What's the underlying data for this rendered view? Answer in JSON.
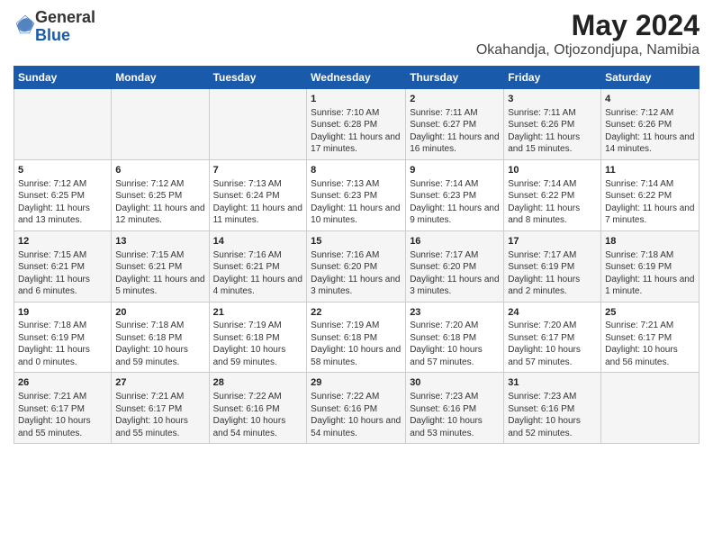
{
  "logo": {
    "general": "General",
    "blue": "Blue"
  },
  "title": "May 2024",
  "subtitle": "Okahandja, Otjozondjupa, Namibia",
  "days_of_week": [
    "Sunday",
    "Monday",
    "Tuesday",
    "Wednesday",
    "Thursday",
    "Friday",
    "Saturday"
  ],
  "weeks": [
    [
      {
        "num": "",
        "info": ""
      },
      {
        "num": "",
        "info": ""
      },
      {
        "num": "",
        "info": ""
      },
      {
        "num": "1",
        "info": "Sunrise: 7:10 AM\nSunset: 6:28 PM\nDaylight: 11 hours and 17 minutes."
      },
      {
        "num": "2",
        "info": "Sunrise: 7:11 AM\nSunset: 6:27 PM\nDaylight: 11 hours and 16 minutes."
      },
      {
        "num": "3",
        "info": "Sunrise: 7:11 AM\nSunset: 6:26 PM\nDaylight: 11 hours and 15 minutes."
      },
      {
        "num": "4",
        "info": "Sunrise: 7:12 AM\nSunset: 6:26 PM\nDaylight: 11 hours and 14 minutes."
      }
    ],
    [
      {
        "num": "5",
        "info": "Sunrise: 7:12 AM\nSunset: 6:25 PM\nDaylight: 11 hours and 13 minutes."
      },
      {
        "num": "6",
        "info": "Sunrise: 7:12 AM\nSunset: 6:25 PM\nDaylight: 11 hours and 12 minutes."
      },
      {
        "num": "7",
        "info": "Sunrise: 7:13 AM\nSunset: 6:24 PM\nDaylight: 11 hours and 11 minutes."
      },
      {
        "num": "8",
        "info": "Sunrise: 7:13 AM\nSunset: 6:23 PM\nDaylight: 11 hours and 10 minutes."
      },
      {
        "num": "9",
        "info": "Sunrise: 7:14 AM\nSunset: 6:23 PM\nDaylight: 11 hours and 9 minutes."
      },
      {
        "num": "10",
        "info": "Sunrise: 7:14 AM\nSunset: 6:22 PM\nDaylight: 11 hours and 8 minutes."
      },
      {
        "num": "11",
        "info": "Sunrise: 7:14 AM\nSunset: 6:22 PM\nDaylight: 11 hours and 7 minutes."
      }
    ],
    [
      {
        "num": "12",
        "info": "Sunrise: 7:15 AM\nSunset: 6:21 PM\nDaylight: 11 hours and 6 minutes."
      },
      {
        "num": "13",
        "info": "Sunrise: 7:15 AM\nSunset: 6:21 PM\nDaylight: 11 hours and 5 minutes."
      },
      {
        "num": "14",
        "info": "Sunrise: 7:16 AM\nSunset: 6:21 PM\nDaylight: 11 hours and 4 minutes."
      },
      {
        "num": "15",
        "info": "Sunrise: 7:16 AM\nSunset: 6:20 PM\nDaylight: 11 hours and 3 minutes."
      },
      {
        "num": "16",
        "info": "Sunrise: 7:17 AM\nSunset: 6:20 PM\nDaylight: 11 hours and 3 minutes."
      },
      {
        "num": "17",
        "info": "Sunrise: 7:17 AM\nSunset: 6:19 PM\nDaylight: 11 hours and 2 minutes."
      },
      {
        "num": "18",
        "info": "Sunrise: 7:18 AM\nSunset: 6:19 PM\nDaylight: 11 hours and 1 minute."
      }
    ],
    [
      {
        "num": "19",
        "info": "Sunrise: 7:18 AM\nSunset: 6:19 PM\nDaylight: 11 hours and 0 minutes."
      },
      {
        "num": "20",
        "info": "Sunrise: 7:18 AM\nSunset: 6:18 PM\nDaylight: 10 hours and 59 minutes."
      },
      {
        "num": "21",
        "info": "Sunrise: 7:19 AM\nSunset: 6:18 PM\nDaylight: 10 hours and 59 minutes."
      },
      {
        "num": "22",
        "info": "Sunrise: 7:19 AM\nSunset: 6:18 PM\nDaylight: 10 hours and 58 minutes."
      },
      {
        "num": "23",
        "info": "Sunrise: 7:20 AM\nSunset: 6:18 PM\nDaylight: 10 hours and 57 minutes."
      },
      {
        "num": "24",
        "info": "Sunrise: 7:20 AM\nSunset: 6:17 PM\nDaylight: 10 hours and 57 minutes."
      },
      {
        "num": "25",
        "info": "Sunrise: 7:21 AM\nSunset: 6:17 PM\nDaylight: 10 hours and 56 minutes."
      }
    ],
    [
      {
        "num": "26",
        "info": "Sunrise: 7:21 AM\nSunset: 6:17 PM\nDaylight: 10 hours and 55 minutes."
      },
      {
        "num": "27",
        "info": "Sunrise: 7:21 AM\nSunset: 6:17 PM\nDaylight: 10 hours and 55 minutes."
      },
      {
        "num": "28",
        "info": "Sunrise: 7:22 AM\nSunset: 6:16 PM\nDaylight: 10 hours and 54 minutes."
      },
      {
        "num": "29",
        "info": "Sunrise: 7:22 AM\nSunset: 6:16 PM\nDaylight: 10 hours and 54 minutes."
      },
      {
        "num": "30",
        "info": "Sunrise: 7:23 AM\nSunset: 6:16 PM\nDaylight: 10 hours and 53 minutes."
      },
      {
        "num": "31",
        "info": "Sunrise: 7:23 AM\nSunset: 6:16 PM\nDaylight: 10 hours and 52 minutes."
      },
      {
        "num": "",
        "info": ""
      }
    ]
  ]
}
